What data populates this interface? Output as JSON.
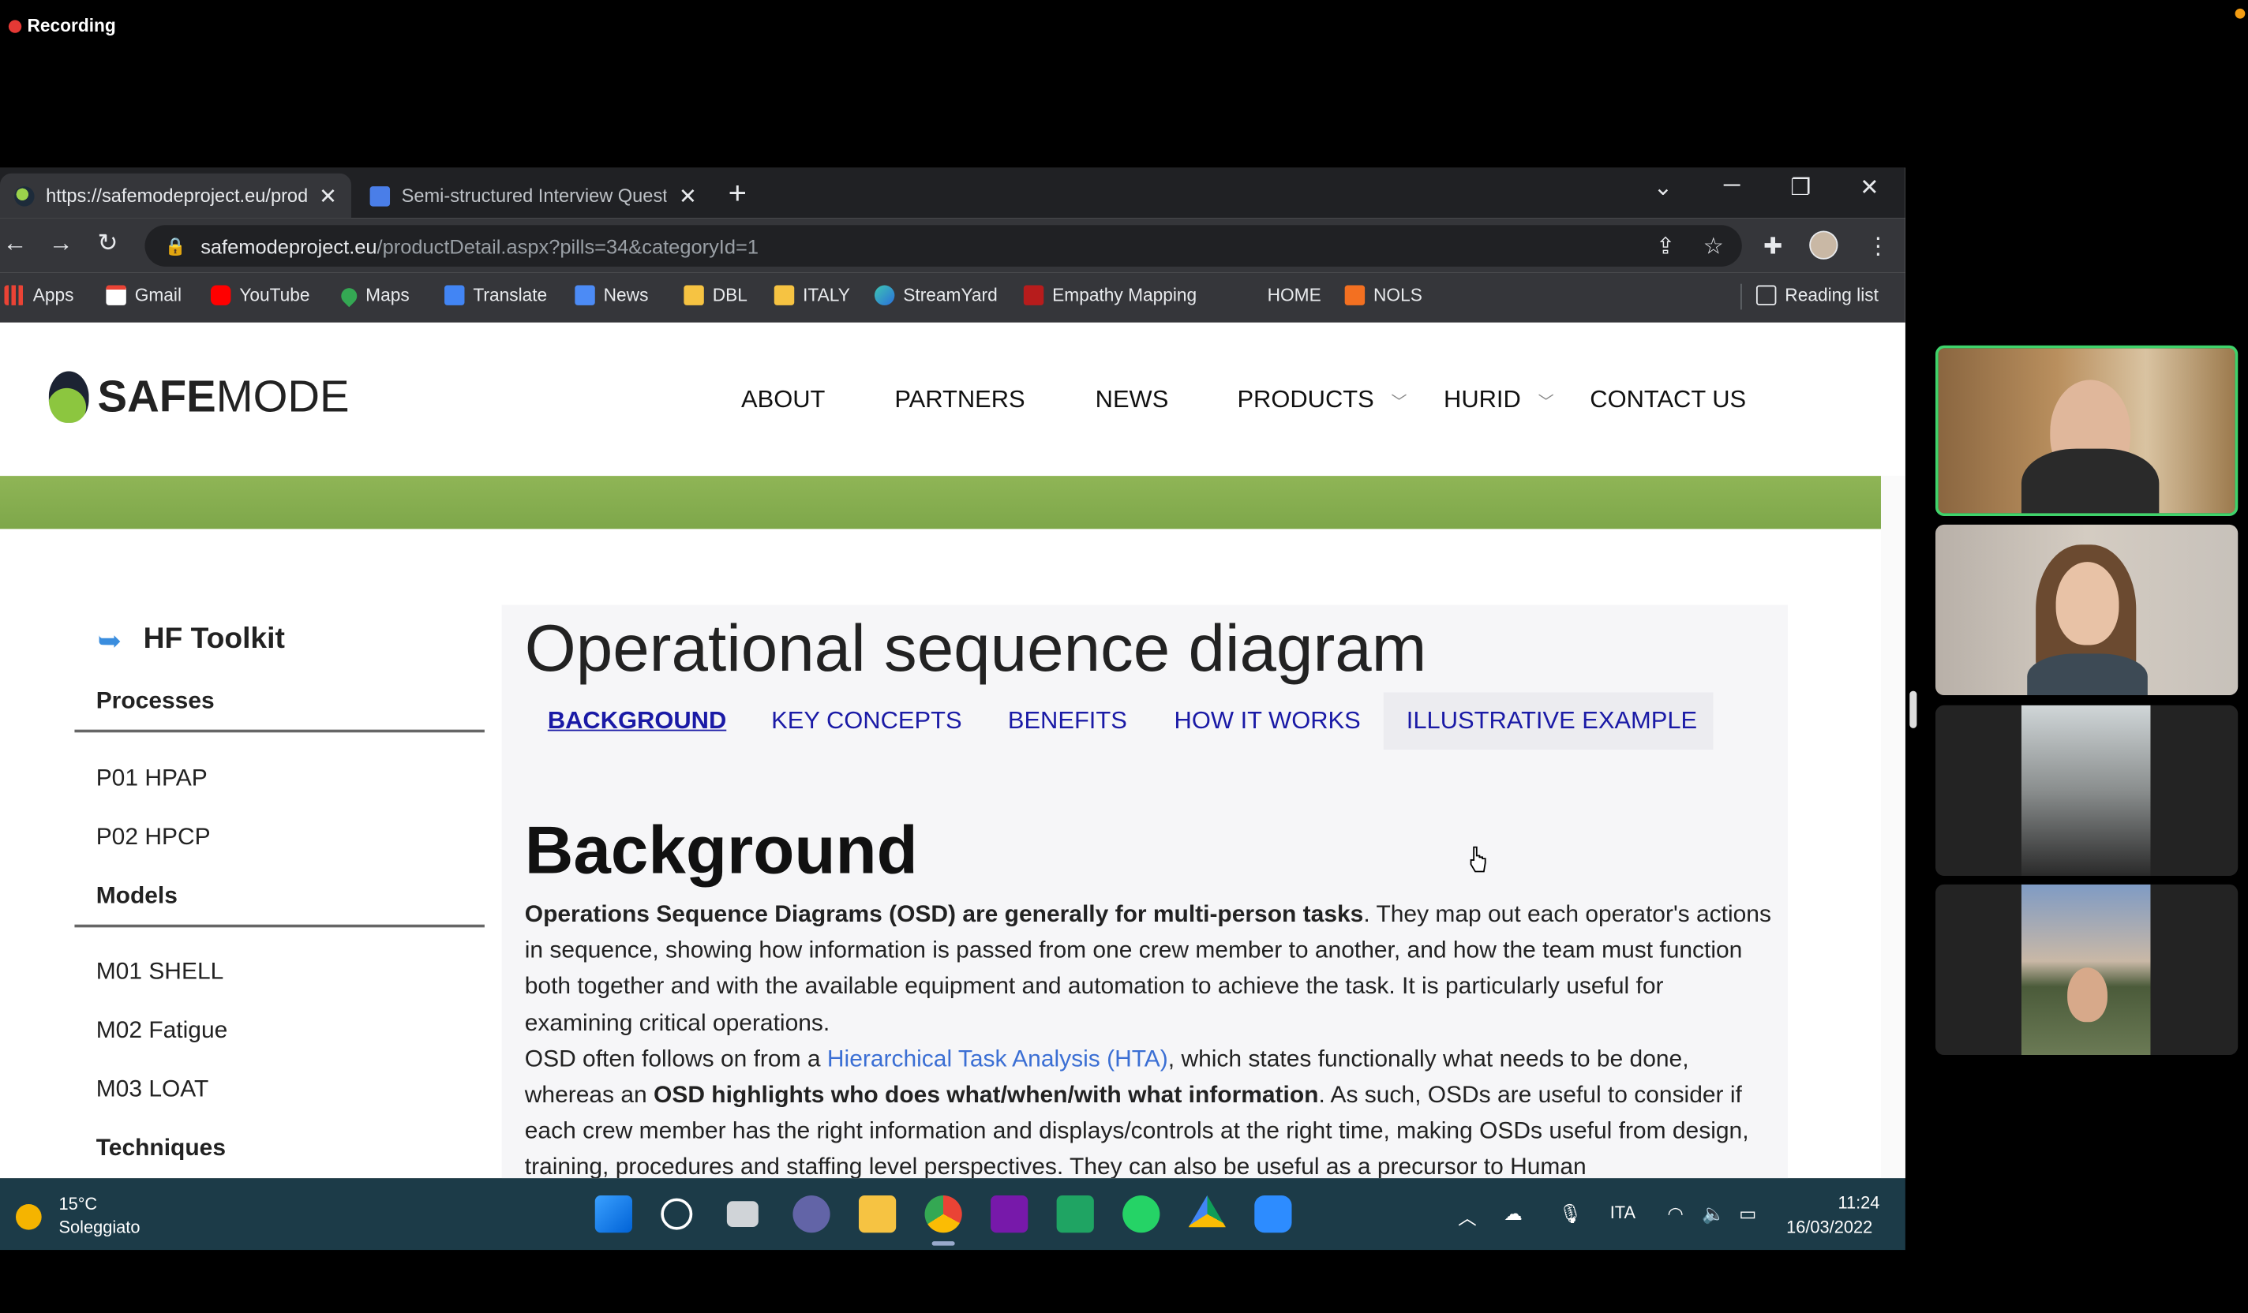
{
  "recording": {
    "label": "Recording"
  },
  "browser": {
    "tabs": [
      {
        "title": "https://safemodeproject.eu/prod"
      },
      {
        "title": "Semi-structured Interview Questi"
      }
    ],
    "url": {
      "host": "safemodeproject.eu",
      "path": "/productDetail.aspx?pills=34&categoryId=1"
    },
    "bookmarks": [
      "Apps",
      "Gmail",
      "YouTube",
      "Maps",
      "Translate",
      "News",
      "DBL",
      "ITALY",
      "StreamYard",
      "Empathy Mapping",
      "HOME",
      "NOLS"
    ],
    "reading_list": "Reading list"
  },
  "site": {
    "logo": {
      "bold": "SAFE",
      "light": "MODE"
    },
    "menu": [
      "ABOUT",
      "PARTNERS",
      "NEWS",
      "PRODUCTS",
      "HURID",
      "CONTACT US"
    ]
  },
  "sidebar": {
    "title": "HF Toolkit",
    "sections": [
      {
        "label": "Processes",
        "items": [
          "P01 HPAP",
          "P02 HPCP"
        ]
      },
      {
        "label": "Models",
        "items": [
          "M01 SHELL",
          "M02 Fatigue",
          "M03 LOAT"
        ]
      },
      {
        "label": "Techniques",
        "items": []
      }
    ]
  },
  "content": {
    "title": "Operational sequence diagram",
    "tabs": [
      "BACKGROUND",
      "KEY CONCEPTS",
      "BENEFITS",
      "HOW IT WORKS",
      "ILLUSTRATIVE EXAMPLE"
    ],
    "active_tab": "BACKGROUND",
    "section_title": "Background",
    "p1_bold": "Operations Sequence Diagrams (OSD) are generally for multi-person tasks",
    "p1_rest": ". They map out each operator's actions in sequence, showing how information is passed from one crew member to another, and how the team must function both together and with the available equipment and automation to achieve the task. It is particularly useful for examining critical operations.",
    "p2_start": "OSD often follows on from a ",
    "p2_link": "Hierarchical Task Analysis (HTA)",
    "p2_mid": ", which states functionally what needs to be done, whereas an ",
    "p2_bold": "OSD highlights who does what/when/with what information",
    "p2_rest": ". As such, OSDs are useful to consider if each crew member has the right information and displays/controls at the right time, making OSDs useful from design, training, procedures and staffing level perspectives. They can also be useful as a precursor to Human"
  },
  "taskbar": {
    "weather_temp": "15°C",
    "weather_desc": "Soleggiato",
    "language": "ITA",
    "time": "11:24",
    "date": "16/03/2022"
  },
  "colors": {
    "accent_green": "#8cc63f",
    "link_blue": "#1a1aa6",
    "taskbar": "#1c3b48"
  }
}
